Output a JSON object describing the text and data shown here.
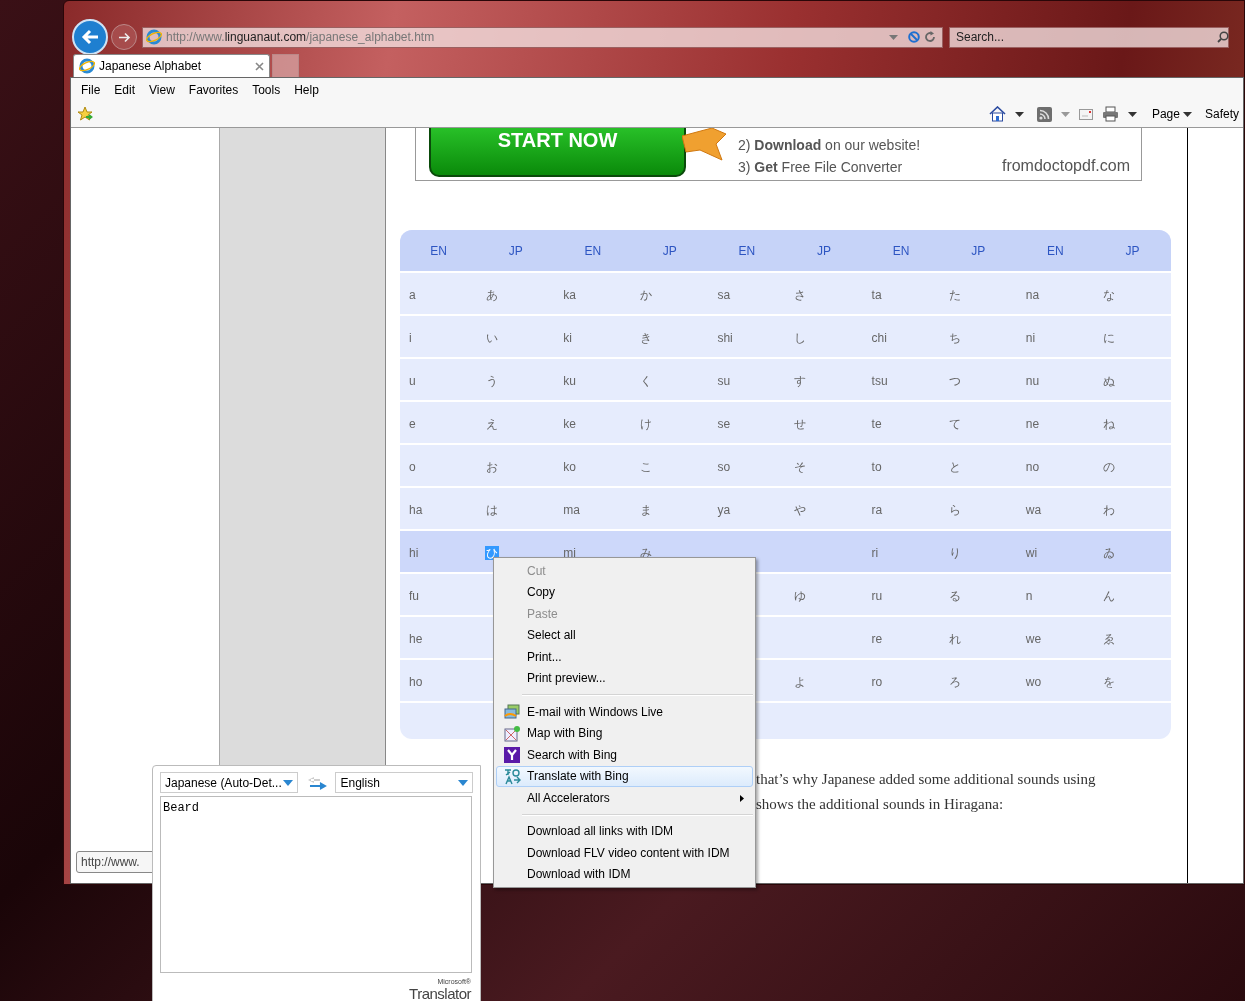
{
  "browser": {
    "address": {
      "prefix": "http://www.",
      "domain": "linguanaut.com",
      "path": "/japanese_alphabet.htm"
    },
    "search": {
      "placeholder": "Search..."
    },
    "tabs": [
      {
        "title": "Japanese Alphabet",
        "selected": true
      }
    ],
    "menu_bar": [
      "File",
      "Edit",
      "View",
      "Favorites",
      "Tools",
      "Help"
    ],
    "command_bar": {
      "page": "Page",
      "safety": "Safety"
    }
  },
  "ad": {
    "button": "START NOW",
    "steps": [
      "2) **Download** on our website!",
      "3) **Get** Free File Converter"
    ],
    "site": "fromdoctopdf.com"
  },
  "table": {
    "columns": [
      "EN",
      "JP",
      "EN",
      "JP",
      "EN",
      "JP",
      "EN",
      "JP",
      "EN",
      "JP"
    ],
    "rows": [
      {
        "highlighted": false,
        "cells": [
          {
            "text": "a",
            "selected": false
          },
          {
            "text": "あ",
            "selected": false
          },
          {
            "text": "ka",
            "selected": false
          },
          {
            "text": "か",
            "selected": false
          },
          {
            "text": "sa",
            "selected": false
          },
          {
            "text": "さ",
            "selected": false
          },
          {
            "text": "ta",
            "selected": false
          },
          {
            "text": "た",
            "selected": false
          },
          {
            "text": "na",
            "selected": false
          },
          {
            "text": "な",
            "selected": false
          }
        ]
      },
      {
        "highlighted": false,
        "cells": [
          {
            "text": "i",
            "selected": false
          },
          {
            "text": "い",
            "selected": false
          },
          {
            "text": "ki",
            "selected": false
          },
          {
            "text": "き",
            "selected": false
          },
          {
            "text": "shi",
            "selected": false
          },
          {
            "text": "し",
            "selected": false
          },
          {
            "text": "chi",
            "selected": false
          },
          {
            "text": "ち",
            "selected": false
          },
          {
            "text": "ni",
            "selected": false
          },
          {
            "text": "に",
            "selected": false
          }
        ]
      },
      {
        "highlighted": false,
        "cells": [
          {
            "text": "u",
            "selected": false
          },
          {
            "text": "う",
            "selected": false
          },
          {
            "text": "ku",
            "selected": false
          },
          {
            "text": "く",
            "selected": false
          },
          {
            "text": "su",
            "selected": false
          },
          {
            "text": "す",
            "selected": false
          },
          {
            "text": "tsu",
            "selected": false
          },
          {
            "text": "つ",
            "selected": false
          },
          {
            "text": "nu",
            "selected": false
          },
          {
            "text": "ぬ",
            "selected": false
          }
        ]
      },
      {
        "highlighted": false,
        "cells": [
          {
            "text": "e",
            "selected": false
          },
          {
            "text": "え",
            "selected": false
          },
          {
            "text": "ke",
            "selected": false
          },
          {
            "text": "け",
            "selected": false
          },
          {
            "text": "se",
            "selected": false
          },
          {
            "text": "せ",
            "selected": false
          },
          {
            "text": "te",
            "selected": false
          },
          {
            "text": "て",
            "selected": false
          },
          {
            "text": "ne",
            "selected": false
          },
          {
            "text": "ね",
            "selected": false
          }
        ]
      },
      {
        "highlighted": false,
        "cells": [
          {
            "text": "o",
            "selected": false
          },
          {
            "text": "お",
            "selected": false
          },
          {
            "text": "ko",
            "selected": false
          },
          {
            "text": "こ",
            "selected": false
          },
          {
            "text": "so",
            "selected": false
          },
          {
            "text": "そ",
            "selected": false
          },
          {
            "text": "to",
            "selected": false
          },
          {
            "text": "と",
            "selected": false
          },
          {
            "text": "no",
            "selected": false
          },
          {
            "text": "の",
            "selected": false
          }
        ]
      },
      {
        "highlighted": false,
        "cells": [
          {
            "text": "ha",
            "selected": false
          },
          {
            "text": "は",
            "selected": false
          },
          {
            "text": "ma",
            "selected": false
          },
          {
            "text": "ま",
            "selected": false
          },
          {
            "text": "ya",
            "selected": false
          },
          {
            "text": "や",
            "selected": false
          },
          {
            "text": "ra",
            "selected": false
          },
          {
            "text": "ら",
            "selected": false
          },
          {
            "text": "wa",
            "selected": false
          },
          {
            "text": "わ",
            "selected": false
          }
        ]
      },
      {
        "highlighted": true,
        "cells": [
          {
            "text": "hi",
            "selected": false
          },
          {
            "text": "ひ",
            "selected": true
          },
          {
            "text": "mi",
            "selected": false
          },
          {
            "text": "み",
            "selected": false
          },
          null,
          null,
          {
            "text": "ri",
            "selected": false
          },
          {
            "text": "り",
            "selected": false
          },
          {
            "text": "wi",
            "selected": false
          },
          {
            "text": "ゐ",
            "selected": false
          }
        ]
      },
      {
        "highlighted": false,
        "cells": [
          {
            "text": "fu",
            "selected": false
          },
          null,
          null,
          null,
          null,
          {
            "text": "ゆ",
            "selected": false
          },
          {
            "text": "ru",
            "selected": false
          },
          {
            "text": "る",
            "selected": false
          },
          {
            "text": "n",
            "selected": false
          },
          {
            "text": "ん",
            "selected": false
          }
        ]
      },
      {
        "highlighted": false,
        "cells": [
          {
            "text": "he",
            "selected": false
          },
          null,
          null,
          null,
          null,
          null,
          {
            "text": "re",
            "selected": false
          },
          {
            "text": "れ",
            "selected": false
          },
          {
            "text": "we",
            "selected": false
          },
          {
            "text": "ゑ",
            "selected": false
          }
        ]
      },
      {
        "highlighted": false,
        "cells": [
          {
            "text": "ho",
            "selected": false
          },
          null,
          null,
          null,
          null,
          {
            "text": "よ",
            "selected": false
          },
          {
            "text": "ro",
            "selected": false
          },
          {
            "text": "ろ",
            "selected": false
          },
          {
            "text": "wo",
            "selected": false
          },
          {
            "text": "を",
            "selected": false
          }
        ]
      }
    ]
  },
  "paragraph": [
    "that’s why Japanese added some additional sounds using",
    "shows the additional sounds in Hiragana:"
  ],
  "status_tooltip": "http://www.",
  "context_menu": [
    {
      "kind": "command",
      "label": "Cut",
      "disabled": true,
      "selected": false
    },
    {
      "kind": "command",
      "label": "Copy",
      "disabled": false,
      "selected": false
    },
    {
      "kind": "command",
      "label": "Paste",
      "disabled": true,
      "selected": false
    },
    {
      "kind": "command",
      "label": "Select all",
      "disabled": false,
      "selected": false
    },
    {
      "kind": "command",
      "label": "Print...",
      "disabled": false,
      "selected": false
    },
    {
      "kind": "command",
      "label": "Print preview...",
      "disabled": false,
      "selected": false
    },
    {
      "kind": "separator"
    },
    {
      "kind": "accelerator",
      "label": "E-mail with Windows Live",
      "disabled": false,
      "selected": false
    },
    {
      "kind": "accelerator",
      "label": "Map with Bing",
      "disabled": false,
      "selected": false
    },
    {
      "kind": "accelerator",
      "label": "Search with Bing",
      "disabled": false,
      "selected": false
    },
    {
      "kind": "accelerator",
      "label": "Translate with Bing",
      "disabled": false,
      "selected": true
    },
    {
      "kind": "submenu",
      "label": "All Accelerators",
      "disabled": false,
      "selected": false
    },
    {
      "kind": "separator"
    },
    {
      "kind": "command",
      "label": "Download all links with IDM",
      "disabled": false,
      "selected": false
    },
    {
      "kind": "command",
      "label": "Download FLV video content with IDM",
      "disabled": false,
      "selected": false
    },
    {
      "kind": "command",
      "label": "Download with IDM",
      "disabled": false,
      "selected": false
    }
  ],
  "translator": {
    "source_language": "Japanese (Auto-Det...",
    "target_language": "English",
    "result": "Beard",
    "brand_small": "Microsoft®",
    "brand": "Translator"
  }
}
